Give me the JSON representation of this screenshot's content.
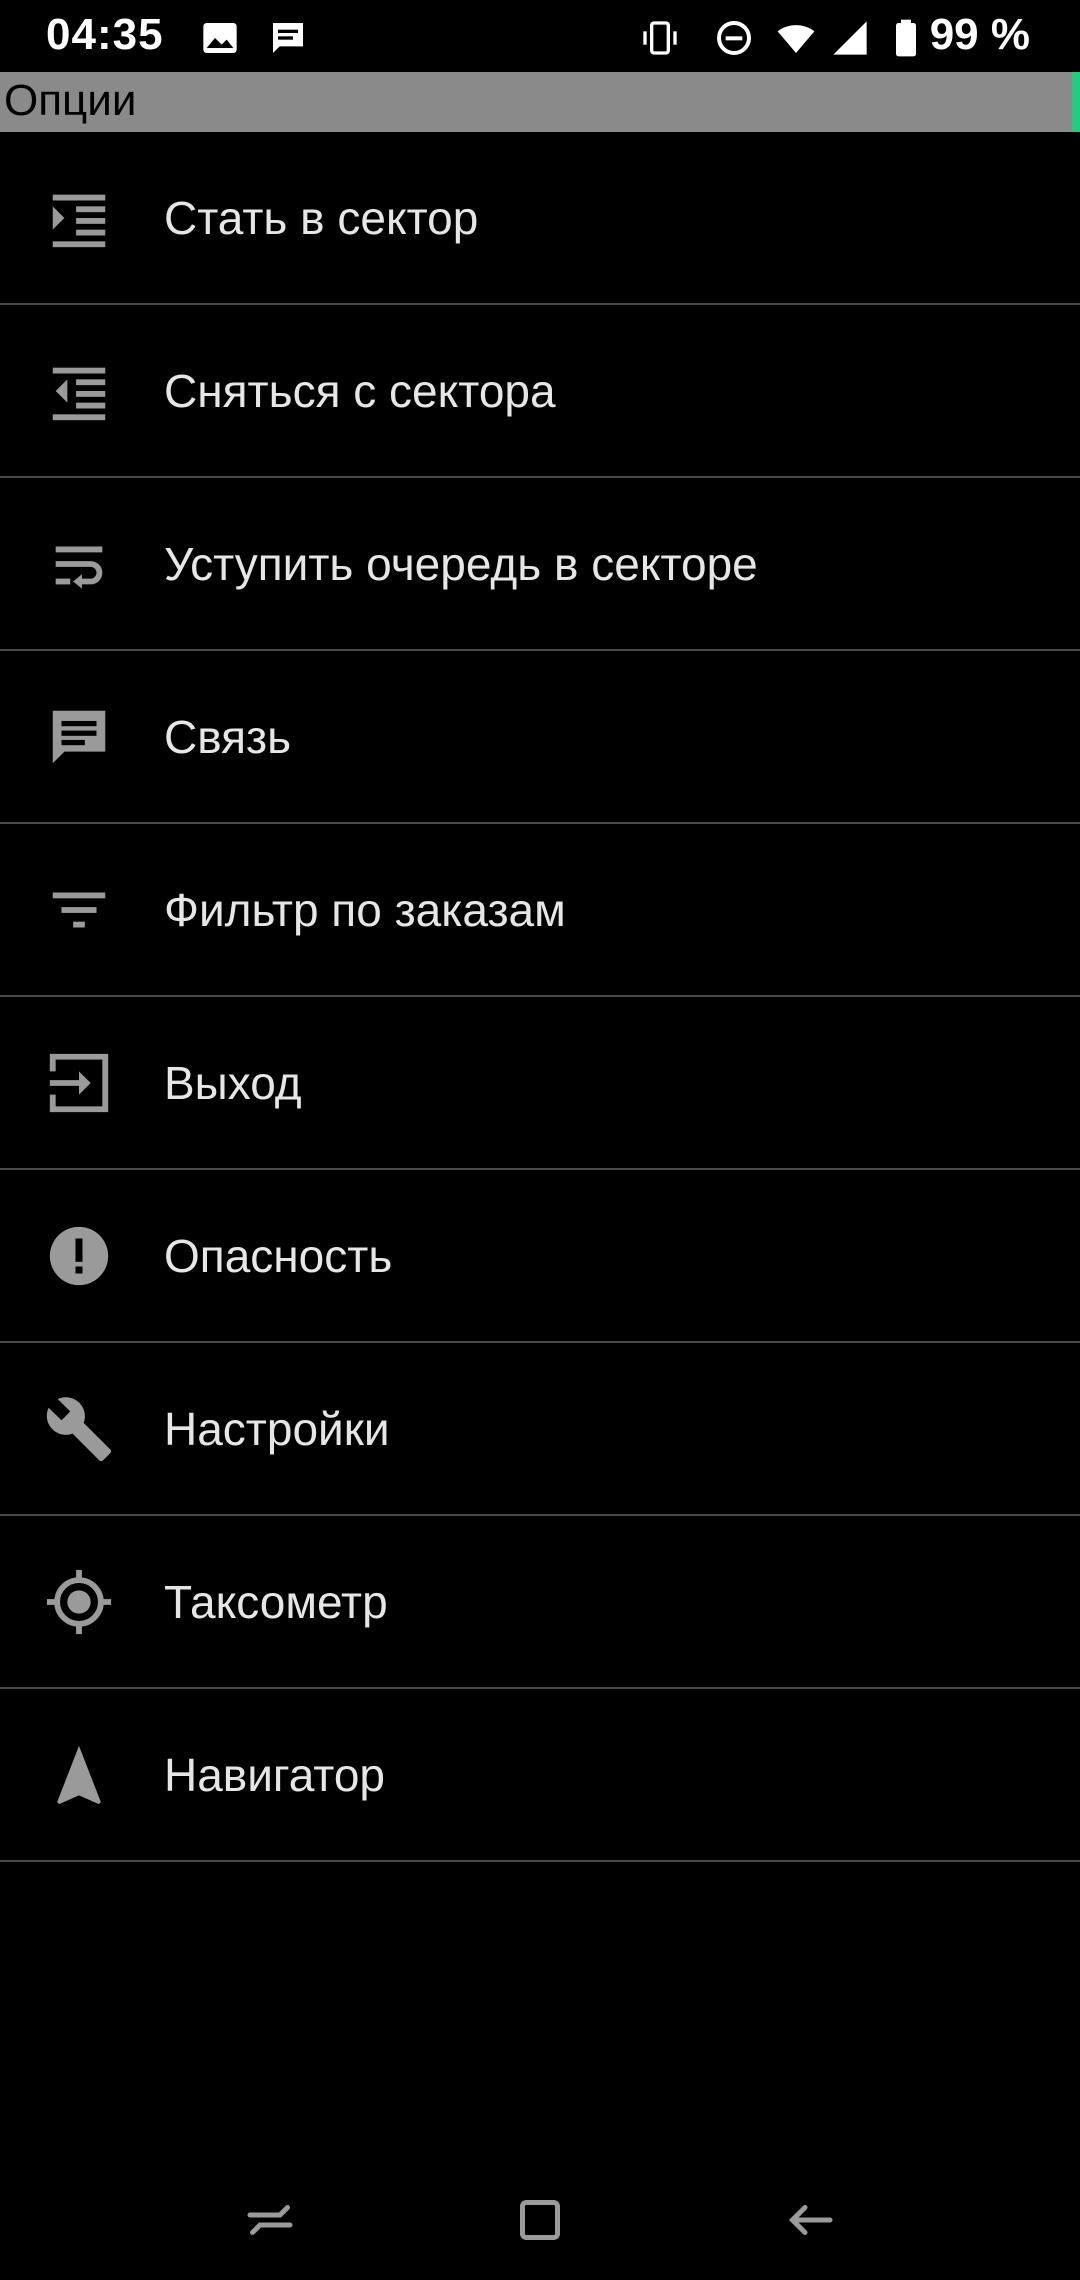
{
  "status_bar": {
    "time": "04:35",
    "battery": "99 %",
    "icons": [
      "image-icon",
      "message-icon",
      "vibrate-icon",
      "dnd-icon",
      "wifi-icon",
      "signal-icon",
      "battery-icon"
    ]
  },
  "title_bar": {
    "title": "Опции",
    "accent_color": "#1fcf7f"
  },
  "menu": {
    "items": [
      {
        "label": "Стать в сектор",
        "icon": "indent-increase-icon"
      },
      {
        "label": "Сняться с сектора",
        "icon": "indent-decrease-icon"
      },
      {
        "label": "Уступить очередь в секторе",
        "icon": "wrap-text-icon"
      },
      {
        "label": "Связь",
        "icon": "chat-icon"
      },
      {
        "label": "Фильтр по заказам",
        "icon": "filter-icon"
      },
      {
        "label": "Выход",
        "icon": "exit-icon"
      },
      {
        "label": "Опасность",
        "icon": "alert-icon"
      },
      {
        "label": "Настройки",
        "icon": "wrench-icon"
      },
      {
        "label": "Таксометр",
        "icon": "target-icon"
      },
      {
        "label": "Навигатор",
        "icon": "navigation-icon"
      }
    ]
  },
  "nav_bar": {
    "buttons": [
      "recents-icon",
      "home-icon",
      "back-icon"
    ]
  },
  "colors": {
    "background": "#000000",
    "title_bar": "#8a8a8a",
    "divider": "#4a4a4a",
    "icon": "#9a9a9a",
    "text": "#e6e6e6"
  }
}
